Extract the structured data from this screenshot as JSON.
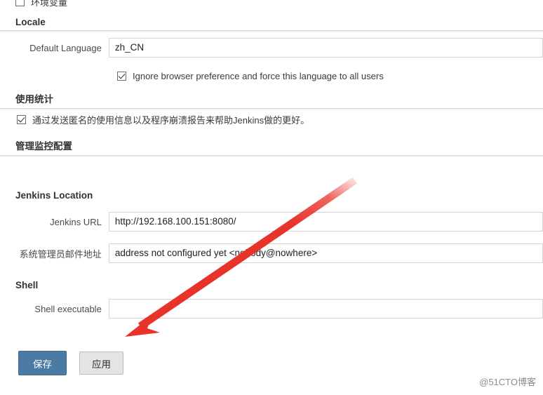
{
  "page": {
    "watermark": "@51CTO博客"
  },
  "top_partial_row": {
    "checkbox_label": "环境变量",
    "checked": false
  },
  "sections": {
    "locale": {
      "heading": "Locale",
      "default_language": {
        "label": "Default Language",
        "value": "zh_CN",
        "placeholder": ""
      },
      "force_language": {
        "label": "Ignore browser preference and force this language to all users",
        "checked": true
      }
    },
    "usage_stats": {
      "heading": "使用统计",
      "option": {
        "label": "通过发送匿名的使用信息以及程序崩溃报告来帮助Jenkins做的更好。",
        "checked": true
      }
    },
    "monitoring": {
      "heading": "管理监控配置"
    },
    "jenkins_location": {
      "heading": "Jenkins Location",
      "jenkins_url": {
        "label": "Jenkins URL",
        "value": "http://192.168.100.151:8080/",
        "placeholder": ""
      },
      "admin_email": {
        "label": "系统管理员邮件地址",
        "value": "address not configured yet <nobody@nowhere>",
        "placeholder": ""
      }
    },
    "shell": {
      "heading": "Shell",
      "shell_executable": {
        "label": "Shell executable",
        "value": "",
        "placeholder": ""
      }
    }
  },
  "buttons": {
    "save": "保存",
    "apply": "应用"
  },
  "annotation": {
    "arrow_color": "#e8332a",
    "arrow_from": "505,258",
    "arrow_to": "180,478"
  }
}
